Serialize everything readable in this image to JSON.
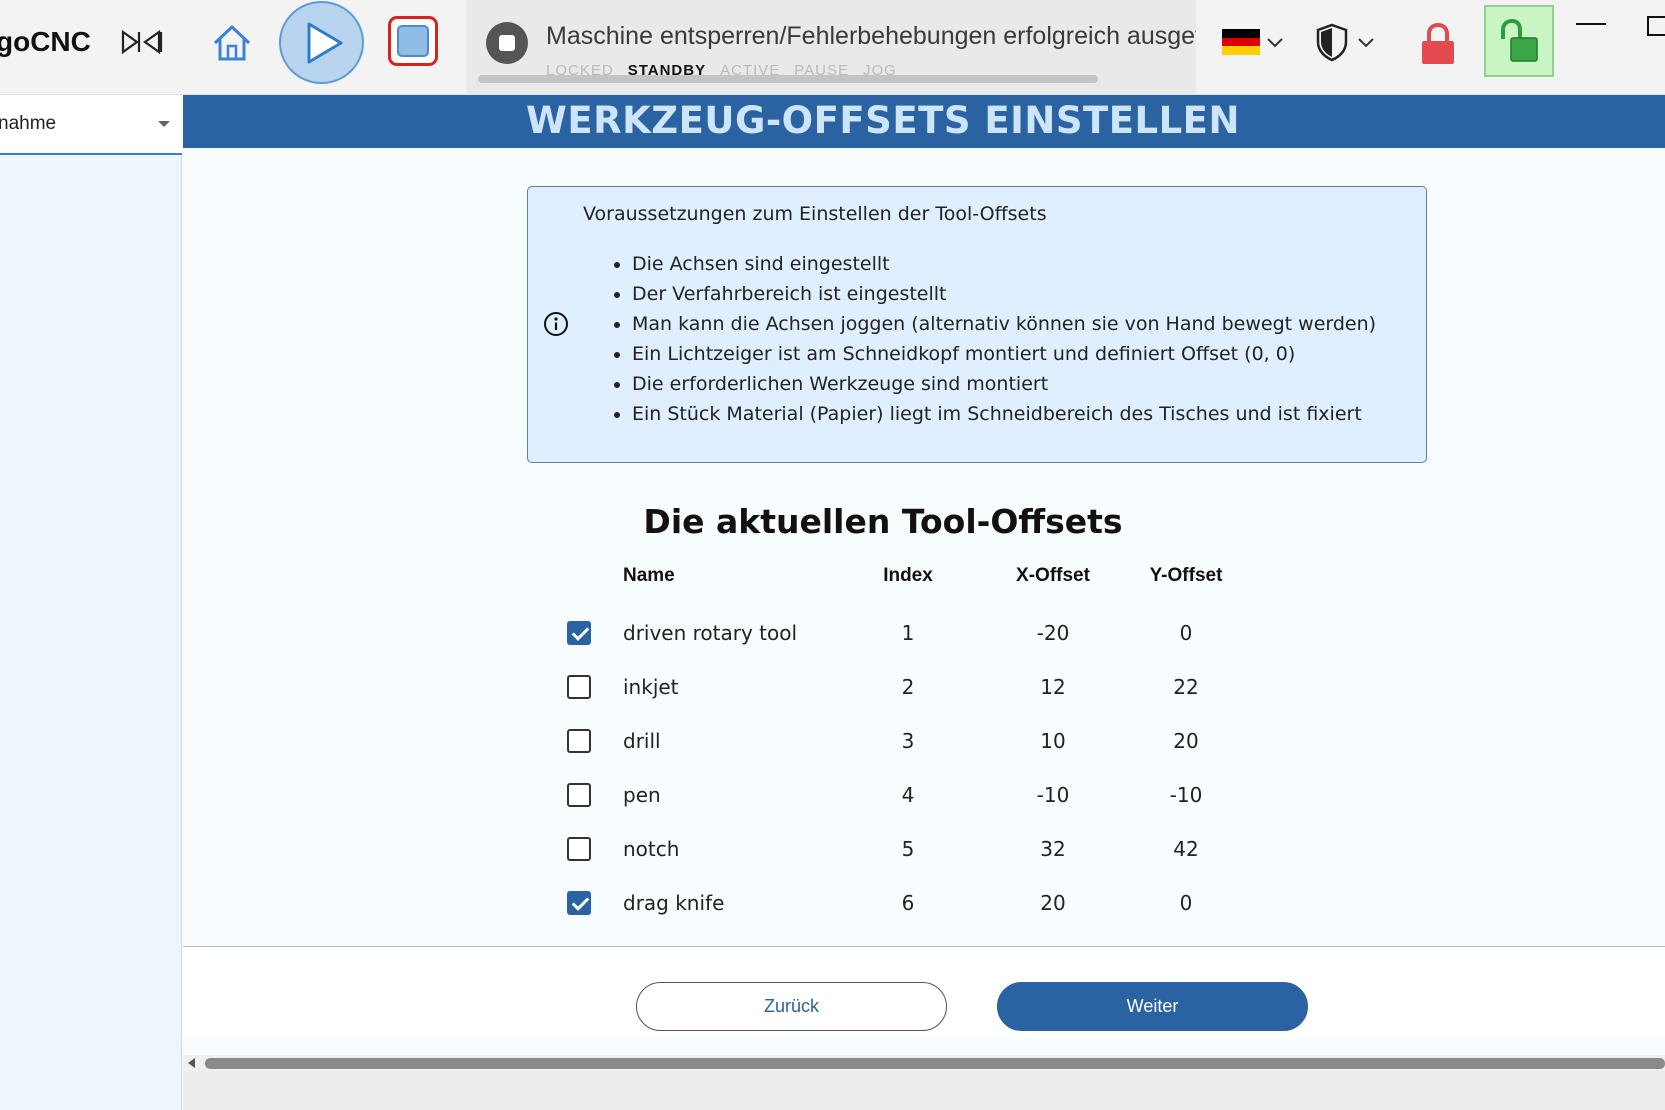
{
  "toolbar": {
    "app_name": "goCNC",
    "status_message": "Maschine entsperren/Fehlerbehebungen erfolgreich ausgeführt",
    "machine_states": [
      "LOCKED",
      "STANDBY",
      "ACTIVE",
      "PAUSE",
      "JOG"
    ],
    "active_state": "STANDBY",
    "language": "de"
  },
  "sidebar": {
    "wizard_select_value": "nahme"
  },
  "main": {
    "title": "WERKZEUG-OFFSETS EINSTELLEN",
    "info": {
      "heading": "Voraussetzungen zum Einstellen der Tool-Offsets",
      "items": [
        "Die Achsen sind eingestellt",
        "Der Verfahrbereich ist eingestellt",
        "Man kann die Achsen joggen (alternativ können sie von Hand bewegt werden)",
        "Ein Lichtzeiger ist am Schneidkopf montiert und definiert Offset (0, 0)",
        "Die erforderlichen Werkzeuge sind montiert",
        "Ein Stück Material (Papier) liegt im Schneidbereich des Tisches und ist fixiert"
      ]
    },
    "offsets_heading": "Die aktuellen Tool-Offsets",
    "table": {
      "headers": {
        "name": "Name",
        "index": "Index",
        "x_offset": "X-Offset",
        "y_offset": "Y-Offset"
      },
      "rows": [
        {
          "checked": true,
          "name": "driven rotary tool",
          "index": "1",
          "x": "-20",
          "y": "0"
        },
        {
          "checked": false,
          "name": "inkjet",
          "index": "2",
          "x": "12",
          "y": "22"
        },
        {
          "checked": false,
          "name": "drill",
          "index": "3",
          "x": "10",
          "y": "20"
        },
        {
          "checked": false,
          "name": "pen",
          "index": "4",
          "x": "-10",
          "y": "-10"
        },
        {
          "checked": false,
          "name": "notch",
          "index": "5",
          "x": "32",
          "y": "42"
        },
        {
          "checked": true,
          "name": "drag knife",
          "index": "6",
          "x": "20",
          "y": "0"
        }
      ]
    },
    "buttons": {
      "back": "Zurück",
      "next": "Weiter"
    }
  },
  "colors": {
    "primary": "#2b62a1",
    "title_text": "#cde5fb",
    "info_bg": "#e0efff",
    "sidebar_bg": "#edf6fd",
    "stop_red": "#d9211e",
    "unlock_green_bg": "#c8f5c3",
    "lock_red": "#e24a4f"
  },
  "icons": [
    "skip-icon",
    "home-icon",
    "play-icon",
    "stop-icon",
    "status-stop-icon",
    "german-flag-icon",
    "chevron-down-icon",
    "shield-icon",
    "lock-closed-icon",
    "lock-open-icon",
    "minimize-icon",
    "maximize-icon",
    "info-icon",
    "dropdown-arrow-icon"
  ]
}
